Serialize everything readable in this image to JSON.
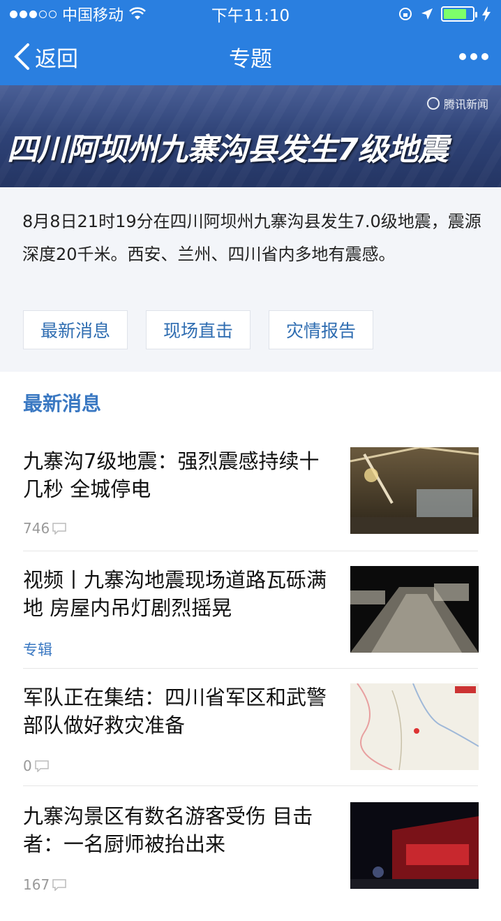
{
  "status_bar": {
    "carrier": "中国移动",
    "time": "下午11:10"
  },
  "nav": {
    "back_label": "返回",
    "title": "专题"
  },
  "banner": {
    "brand": "腾讯新闻",
    "title": "四川阿坝州九寨沟县发生7级地震"
  },
  "intro": {
    "text": "8月8日21时19分在四川阿坝州九寨沟县发生7.0级地震，震源深度20千米。西安、兰州、四川省内多地有震感。",
    "tabs": [
      "最新消息",
      "现场直击",
      "灾情报告"
    ]
  },
  "section": {
    "title": "最新消息"
  },
  "news": [
    {
      "title": "九寨沟7级地震：强烈震感持续十几秒 全城停电",
      "meta": "746",
      "meta_type": "comments",
      "thumb": "collapsed-building-photo"
    },
    {
      "title": "视频丨九寨沟地震现场道路瓦砾满地 房屋内吊灯剧烈摇晃",
      "meta": "专辑",
      "meta_type": "tag",
      "thumb": "night-road-photo"
    },
    {
      "title": "军队正在集结：四川省军区和武警部队做好救灾准备",
      "meta": "0",
      "meta_type": "comments",
      "thumb": "map-image"
    },
    {
      "title": "九寨沟景区有数名游客受伤 目击者：一名厨师被抬出来",
      "meta": "167",
      "meta_type": "comments",
      "thumb": "night-street-photo"
    }
  ],
  "colors": {
    "nav_bg": "#2a7fe0",
    "accent": "#3a78c2"
  }
}
